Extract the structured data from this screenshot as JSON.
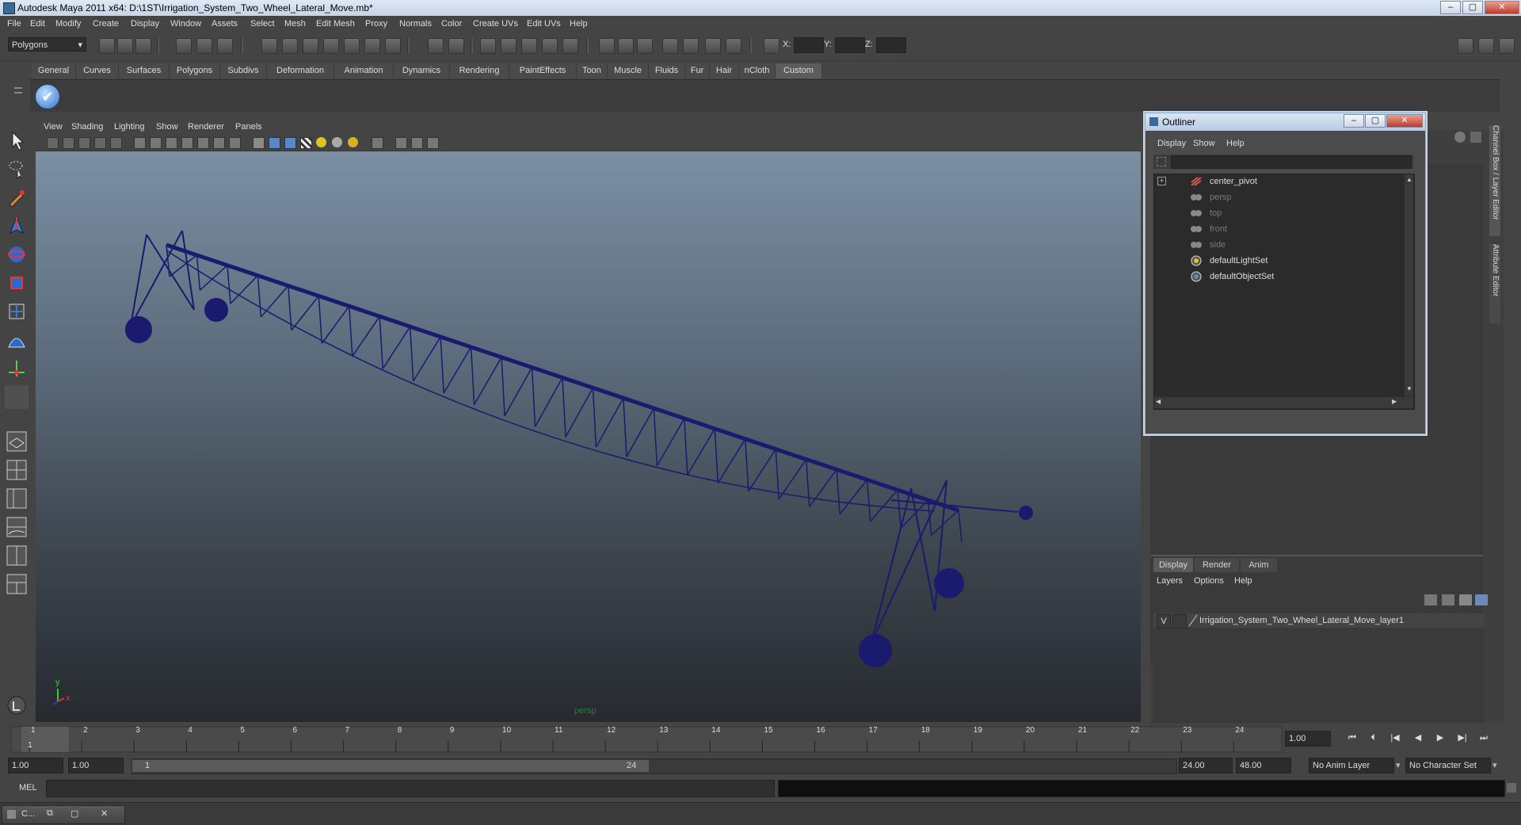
{
  "window": {
    "title": "Autodesk Maya 2011 x64: D:\\1ST\\Irrigation_System_Two_Wheel_Lateral_Move.mb*",
    "buttons": [
      "‒",
      "▢",
      "✕"
    ]
  },
  "menubar": [
    "File",
    "Edit",
    "Modify",
    "Create",
    "Display",
    "Window",
    "Assets",
    "Select",
    "Mesh",
    "Edit Mesh",
    "Proxy",
    "Normals",
    "Color",
    "Create UVs",
    "Edit UVs",
    "Help"
  ],
  "toolbar": {
    "mode": "Polygons",
    "x_label": "X:",
    "y_label": "Y:",
    "z_label": "Z:"
  },
  "shelf": {
    "tabs": [
      "General",
      "Curves",
      "Surfaces",
      "Polygons",
      "Subdivs",
      "Deformation",
      "Animation",
      "Dynamics",
      "Rendering",
      "PaintEffects",
      "Toon",
      "Muscle",
      "Fluids",
      "Fur",
      "Hair",
      "nCloth",
      "Custom"
    ],
    "active": "Custom"
  },
  "viewport": {
    "menu": [
      "View",
      "Shading",
      "Lighting",
      "Show",
      "Renderer",
      "Panels"
    ],
    "camera_label": "persp",
    "axis_y": "y",
    "axis_x": "x",
    "wire_color": "#1a1a6e"
  },
  "outliner": {
    "title": "Outliner",
    "menu": [
      "Display",
      "Show",
      "Help"
    ],
    "items": [
      {
        "label": "center_pivot",
        "icon": "transform-icon",
        "dim": false
      },
      {
        "label": "persp",
        "icon": "camera-icon",
        "dim": true
      },
      {
        "label": "top",
        "icon": "camera-icon",
        "dim": true
      },
      {
        "label": "front",
        "icon": "camera-icon",
        "dim": true
      },
      {
        "label": "side",
        "icon": "camera-icon",
        "dim": true
      },
      {
        "label": "defaultLightSet",
        "icon": "set-icon",
        "dim": false
      },
      {
        "label": "defaultObjectSet",
        "icon": "set-icon",
        "dim": false
      }
    ]
  },
  "channel_box": {
    "side_tabs": [
      "Channel Box / Layer Editor",
      "Attribute Editor"
    ]
  },
  "layer_editor": {
    "tabs": [
      "Display",
      "Render",
      "Anim"
    ],
    "active_tab": "Display",
    "menu": [
      "Layers",
      "Options",
      "Help"
    ],
    "layer": {
      "visibility": "V",
      "name": "Irrigation_System_Two_Wheel_Lateral_Move_layer1"
    }
  },
  "timeline": {
    "ticks": [
      "1",
      "2",
      "3",
      "4",
      "5",
      "6",
      "7",
      "8",
      "9",
      "10",
      "11",
      "12",
      "13",
      "14",
      "15",
      "16",
      "17",
      "18",
      "19",
      "20",
      "21",
      "22",
      "23",
      "24"
    ],
    "current_frame": "1",
    "current_time_field": "1.00"
  },
  "range": {
    "start": "1.00",
    "playback_start": "1.00",
    "slider_start": "1",
    "slider_end": "24",
    "playback_end": "24.00",
    "end": "48.00",
    "anim_layer": "No Anim Layer",
    "character_set": "No Character Set"
  },
  "cmdline": {
    "label": "MEL"
  },
  "taskbar": {
    "item": "C..."
  }
}
